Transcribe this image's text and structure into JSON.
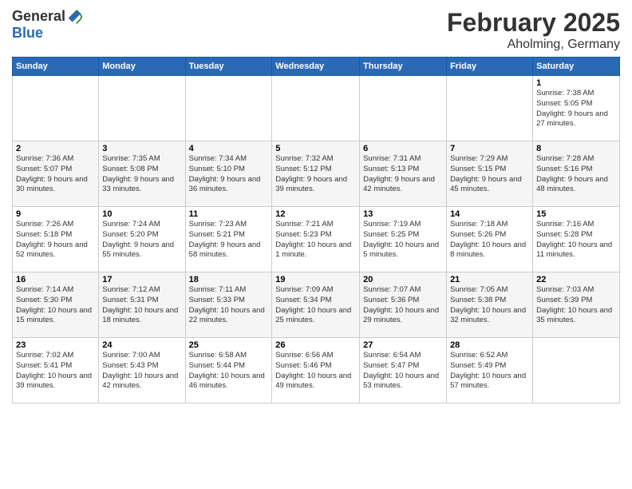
{
  "header": {
    "logo_general": "General",
    "logo_blue": "Blue",
    "month": "February 2025",
    "location": "Aholming, Germany"
  },
  "weekdays": [
    "Sunday",
    "Monday",
    "Tuesday",
    "Wednesday",
    "Thursday",
    "Friday",
    "Saturday"
  ],
  "weeks": [
    [
      {
        "day": "",
        "info": ""
      },
      {
        "day": "",
        "info": ""
      },
      {
        "day": "",
        "info": ""
      },
      {
        "day": "",
        "info": ""
      },
      {
        "day": "",
        "info": ""
      },
      {
        "day": "",
        "info": ""
      },
      {
        "day": "1",
        "info": "Sunrise: 7:38 AM\nSunset: 5:05 PM\nDaylight: 9 hours and 27 minutes."
      }
    ],
    [
      {
        "day": "2",
        "info": "Sunrise: 7:36 AM\nSunset: 5:07 PM\nDaylight: 9 hours and 30 minutes."
      },
      {
        "day": "3",
        "info": "Sunrise: 7:35 AM\nSunset: 5:08 PM\nDaylight: 9 hours and 33 minutes."
      },
      {
        "day": "4",
        "info": "Sunrise: 7:34 AM\nSunset: 5:10 PM\nDaylight: 9 hours and 36 minutes."
      },
      {
        "day": "5",
        "info": "Sunrise: 7:32 AM\nSunset: 5:12 PM\nDaylight: 9 hours and 39 minutes."
      },
      {
        "day": "6",
        "info": "Sunrise: 7:31 AM\nSunset: 5:13 PM\nDaylight: 9 hours and 42 minutes."
      },
      {
        "day": "7",
        "info": "Sunrise: 7:29 AM\nSunset: 5:15 PM\nDaylight: 9 hours and 45 minutes."
      },
      {
        "day": "8",
        "info": "Sunrise: 7:28 AM\nSunset: 5:16 PM\nDaylight: 9 hours and 48 minutes."
      }
    ],
    [
      {
        "day": "9",
        "info": "Sunrise: 7:26 AM\nSunset: 5:18 PM\nDaylight: 9 hours and 52 minutes."
      },
      {
        "day": "10",
        "info": "Sunrise: 7:24 AM\nSunset: 5:20 PM\nDaylight: 9 hours and 55 minutes."
      },
      {
        "day": "11",
        "info": "Sunrise: 7:23 AM\nSunset: 5:21 PM\nDaylight: 9 hours and 58 minutes."
      },
      {
        "day": "12",
        "info": "Sunrise: 7:21 AM\nSunset: 5:23 PM\nDaylight: 10 hours and 1 minute."
      },
      {
        "day": "13",
        "info": "Sunrise: 7:19 AM\nSunset: 5:25 PM\nDaylight: 10 hours and 5 minutes."
      },
      {
        "day": "14",
        "info": "Sunrise: 7:18 AM\nSunset: 5:26 PM\nDaylight: 10 hours and 8 minutes."
      },
      {
        "day": "15",
        "info": "Sunrise: 7:16 AM\nSunset: 5:28 PM\nDaylight: 10 hours and 11 minutes."
      }
    ],
    [
      {
        "day": "16",
        "info": "Sunrise: 7:14 AM\nSunset: 5:30 PM\nDaylight: 10 hours and 15 minutes."
      },
      {
        "day": "17",
        "info": "Sunrise: 7:12 AM\nSunset: 5:31 PM\nDaylight: 10 hours and 18 minutes."
      },
      {
        "day": "18",
        "info": "Sunrise: 7:11 AM\nSunset: 5:33 PM\nDaylight: 10 hours and 22 minutes."
      },
      {
        "day": "19",
        "info": "Sunrise: 7:09 AM\nSunset: 5:34 PM\nDaylight: 10 hours and 25 minutes."
      },
      {
        "day": "20",
        "info": "Sunrise: 7:07 AM\nSunset: 5:36 PM\nDaylight: 10 hours and 29 minutes."
      },
      {
        "day": "21",
        "info": "Sunrise: 7:05 AM\nSunset: 5:38 PM\nDaylight: 10 hours and 32 minutes."
      },
      {
        "day": "22",
        "info": "Sunrise: 7:03 AM\nSunset: 5:39 PM\nDaylight: 10 hours and 35 minutes."
      }
    ],
    [
      {
        "day": "23",
        "info": "Sunrise: 7:02 AM\nSunset: 5:41 PM\nDaylight: 10 hours and 39 minutes."
      },
      {
        "day": "24",
        "info": "Sunrise: 7:00 AM\nSunset: 5:43 PM\nDaylight: 10 hours and 42 minutes."
      },
      {
        "day": "25",
        "info": "Sunrise: 6:58 AM\nSunset: 5:44 PM\nDaylight: 10 hours and 46 minutes."
      },
      {
        "day": "26",
        "info": "Sunrise: 6:56 AM\nSunset: 5:46 PM\nDaylight: 10 hours and 49 minutes."
      },
      {
        "day": "27",
        "info": "Sunrise: 6:54 AM\nSunset: 5:47 PM\nDaylight: 10 hours and 53 minutes."
      },
      {
        "day": "28",
        "info": "Sunrise: 6:52 AM\nSunset: 5:49 PM\nDaylight: 10 hours and 57 minutes."
      },
      {
        "day": "",
        "info": ""
      }
    ]
  ]
}
